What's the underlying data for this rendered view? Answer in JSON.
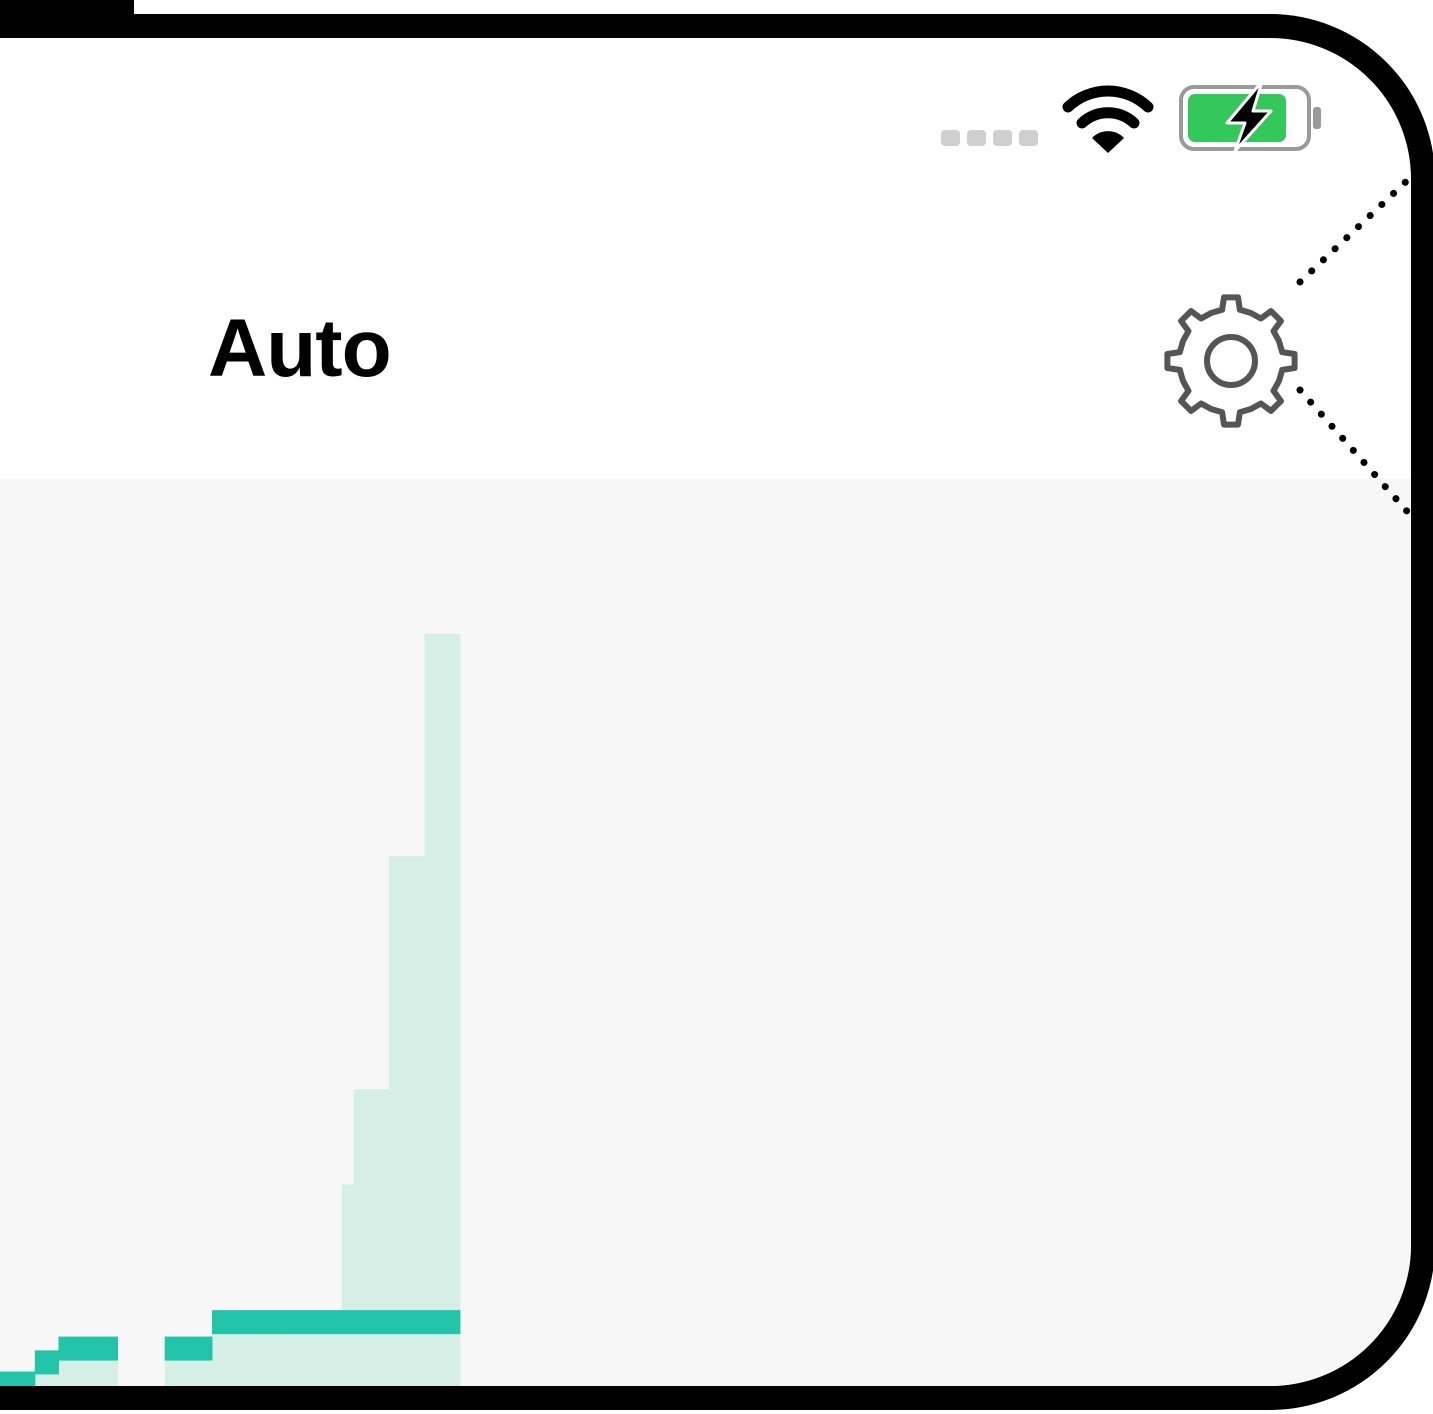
{
  "status_bar": {
    "signal_dots": 4,
    "wifi_icon": "wifi-icon",
    "battery_icon": "battery-charging-icon",
    "battery_color": "#34c759"
  },
  "nav": {
    "title": "Auto",
    "settings_icon": "gear-icon"
  },
  "colors": {
    "accent": "#22c4aa",
    "accent_light": "#d5efe7",
    "content_bg": "#f7f7f7"
  },
  "chart_data": {
    "type": "bar",
    "series": [
      {
        "values": [
          0.42,
          0.42,
          0.42,
          0.42,
          0.42,
          0.42,
          0.62,
          0.62,
          0.75,
          0.75,
          0.75,
          0.75,
          0.75,
          0.75,
          0.75,
          0.75,
          0.75,
          0.75,
          0.75,
          0.75,
          0.75,
          1.0,
          1.0,
          1.0,
          1.0,
          1.0,
          1.0,
          1.0,
          1.0,
          1.0,
          1.0,
          1.0,
          2.3,
          3.2,
          3.2,
          3.2,
          5.4,
          5.4,
          5.4,
          7.5,
          7.5,
          7.5
        ]
      },
      {
        "values": [
          0.42,
          0.42,
          0.42,
          0.42,
          0.42,
          0.42,
          0.62,
          0.62,
          0.75,
          0.75,
          0.75,
          0.75,
          0.75,
          0.75,
          0.75,
          0.75,
          0.75,
          0.75,
          0.75,
          0.75,
          0.75,
          1.0,
          1.0,
          1.0,
          1.0,
          1.0,
          1.0,
          1.0,
          1.0,
          1.0,
          1.0,
          1.0,
          1.0,
          1.0,
          1.0,
          1.0,
          1.0,
          1.0,
          1.0,
          1.0,
          1.0,
          1.0
        ]
      }
    ],
    "ylim": [
      0,
      8.5
    ],
    "grid": false,
    "legend": "none"
  }
}
